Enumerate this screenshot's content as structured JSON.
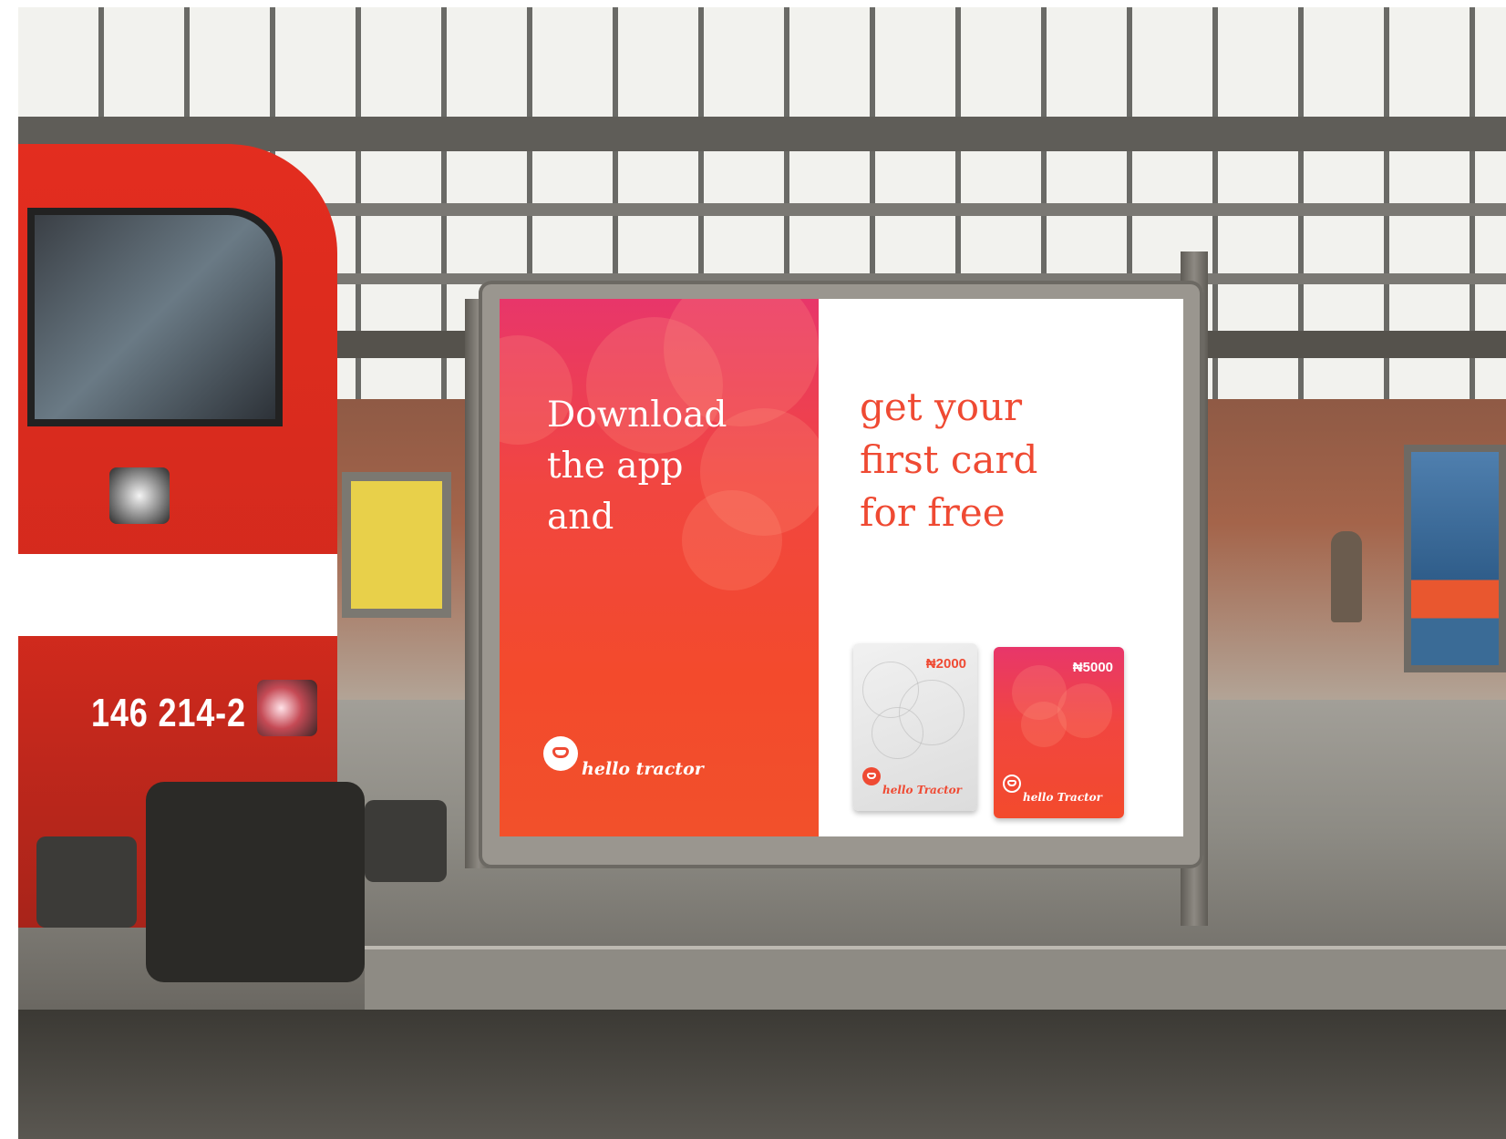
{
  "scene": {
    "train_number": "146 214-2"
  },
  "billboard": {
    "left_text_lines": [
      "Download",
      "the app",
      "and"
    ],
    "right_text_lines": [
      "get your",
      "first card",
      "for free"
    ],
    "brand": "hello tractor",
    "colors": {
      "accent": "#ef4a33",
      "gradient_top": "#e8366a",
      "gradient_bottom": "#f2502b",
      "card_grey": "#e4e4e4"
    },
    "cards": [
      {
        "value": "₦2000",
        "brand": "hello Tractor"
      },
      {
        "value": "₦5000",
        "brand": "hello Tractor"
      }
    ]
  },
  "background_poster": {
    "icons": [
      "person-photo"
    ]
  }
}
